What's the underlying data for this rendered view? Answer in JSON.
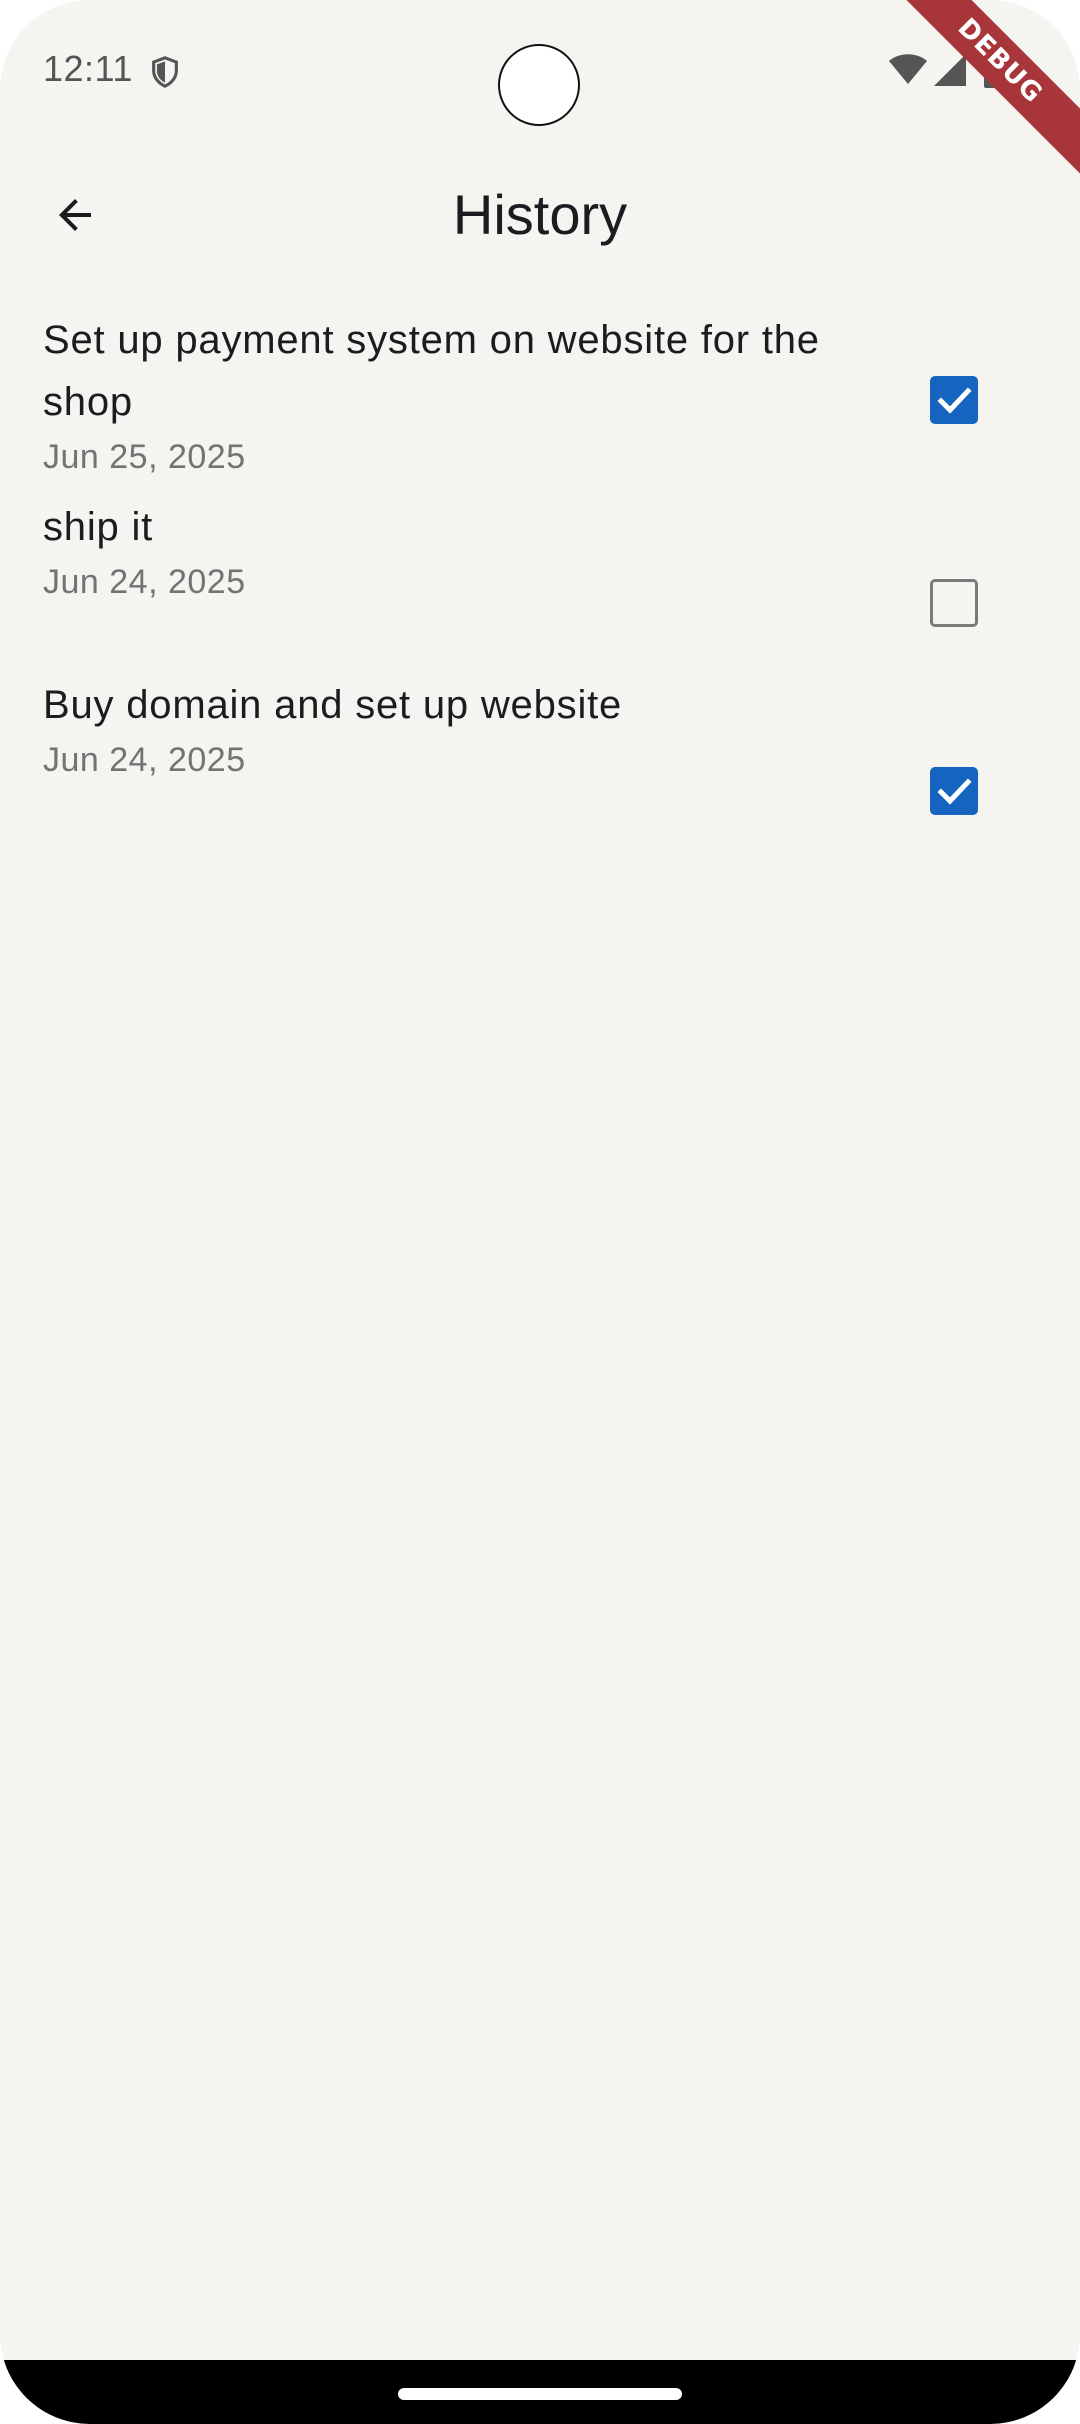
{
  "status_bar": {
    "time": "12:11"
  },
  "debug_banner": "DEBUG",
  "app_bar": {
    "title": "History",
    "back_icon": "arrow-back-icon"
  },
  "history": {
    "items": [
      {
        "title": "Set up payment system on website for the shop",
        "date": "Jun 25, 2025",
        "completed": true
      },
      {
        "title": "ship it",
        "date": "Jun 24, 2025",
        "completed": false
      },
      {
        "title": "Buy domain and set up website",
        "date": "Jun 24, 2025",
        "completed": true
      }
    ]
  },
  "colors": {
    "background": "#f5f4f1",
    "checkbox_checked": "#1565c0",
    "debug_ribbon": "#a8353a"
  }
}
